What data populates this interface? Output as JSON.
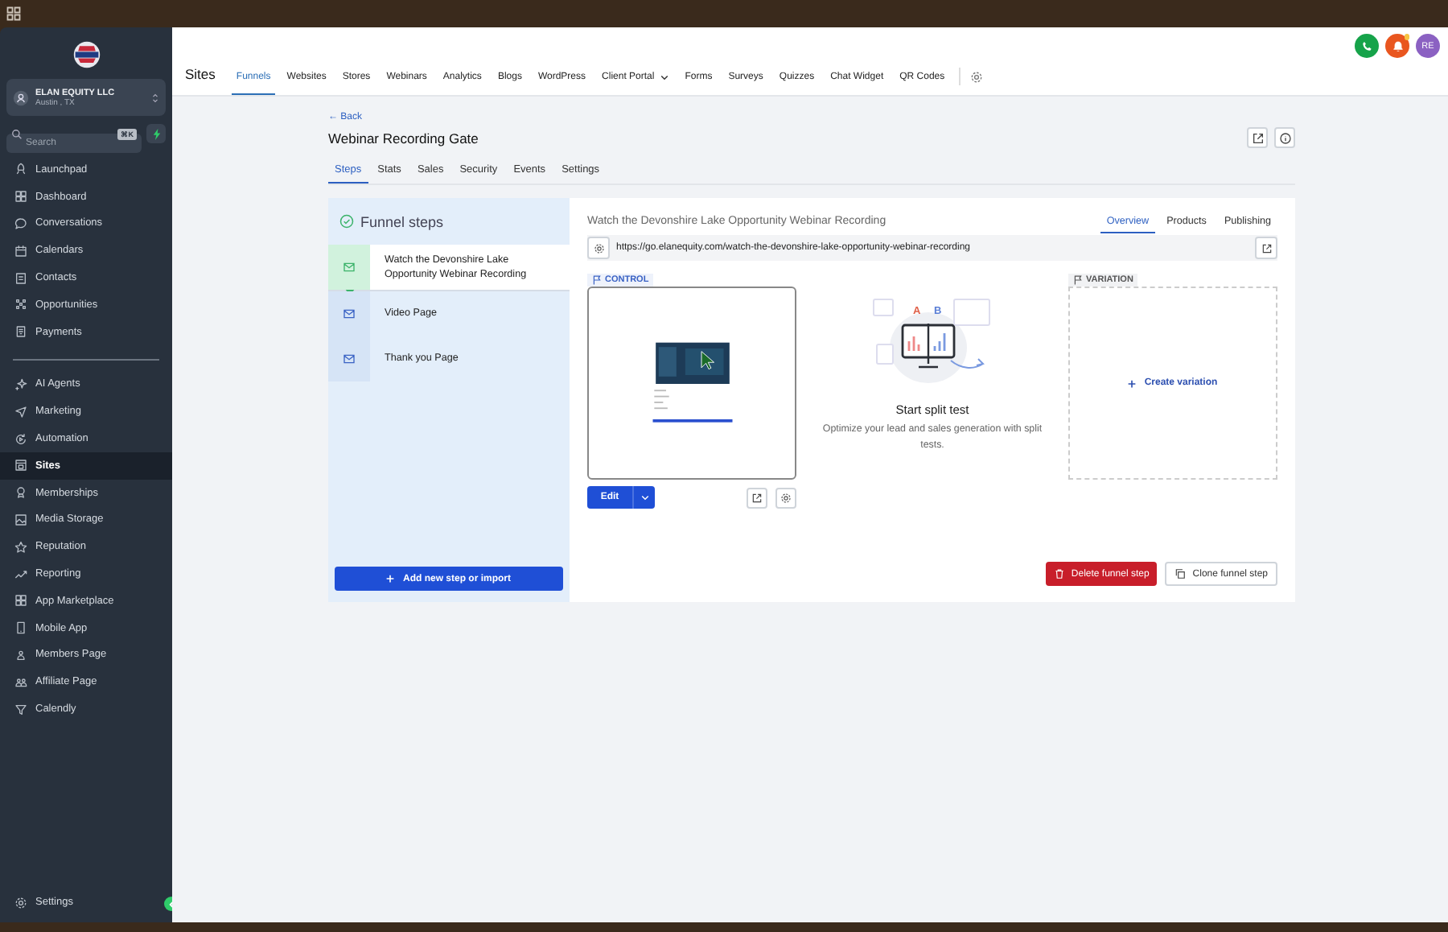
{
  "sidebar": {
    "account": {
      "name": "ELAN EQUITY LLC",
      "location": "Austin , TX"
    },
    "search": {
      "placeholder": "Search",
      "shortcut": "⌘K"
    },
    "groups": [
      [
        {
          "label": "Launchpad",
          "selected": false
        },
        {
          "label": "Dashboard",
          "selected": false
        },
        {
          "label": "Conversations",
          "selected": false
        },
        {
          "label": "Calendars",
          "selected": false
        },
        {
          "label": "Contacts",
          "selected": false
        },
        {
          "label": "Opportunities",
          "selected": false
        },
        {
          "label": "Payments",
          "selected": false
        }
      ],
      [
        {
          "label": "AI Agents",
          "selected": false
        },
        {
          "label": "Marketing",
          "selected": false
        },
        {
          "label": "Automation",
          "selected": false
        },
        {
          "label": "Sites",
          "selected": true
        },
        {
          "label": "Memberships",
          "selected": false
        },
        {
          "label": "Media Storage",
          "selected": false
        },
        {
          "label": "Reputation",
          "selected": false
        },
        {
          "label": "Reporting",
          "selected": false
        },
        {
          "label": "App Marketplace",
          "selected": false
        },
        {
          "label": "Mobile App",
          "selected": false
        },
        {
          "label": "Members Page",
          "selected": false
        },
        {
          "label": "Affiliate Page",
          "selected": false
        },
        {
          "label": "Calendly",
          "selected": false
        }
      ]
    ],
    "settings": "Settings"
  },
  "header": {
    "title": "Sites",
    "avatar": "RE",
    "nav": [
      {
        "label": "Funnels",
        "selected": true
      },
      {
        "label": "Websites",
        "selected": false
      },
      {
        "label": "Stores",
        "selected": false
      },
      {
        "label": "Webinars",
        "selected": false
      },
      {
        "label": "Analytics",
        "selected": false
      },
      {
        "label": "Blogs",
        "selected": false
      },
      {
        "label": "WordPress",
        "selected": false
      },
      {
        "label": "Client Portal",
        "selected": false,
        "dropdown": true
      },
      {
        "label": "Forms",
        "selected": false
      },
      {
        "label": "Surveys",
        "selected": false
      },
      {
        "label": "Quizzes",
        "selected": false
      },
      {
        "label": "Chat Widget",
        "selected": false
      },
      {
        "label": "QR Codes",
        "selected": false
      }
    ]
  },
  "page": {
    "back": "← Back",
    "title": "Webinar Recording Gate",
    "tabs": [
      {
        "label": "Steps",
        "selected": true
      },
      {
        "label": "Stats",
        "selected": false
      },
      {
        "label": "Sales",
        "selected": false
      },
      {
        "label": "Security",
        "selected": false
      },
      {
        "label": "Events",
        "selected": false
      },
      {
        "label": "Settings",
        "selected": false
      }
    ]
  },
  "funnel": {
    "title": "Funnel steps",
    "steps": [
      {
        "name": "Watch the Devonshire Lake Opportunity Webinar Recording",
        "selected": true
      },
      {
        "name": "Video Page",
        "selected": false
      },
      {
        "name": "Thank you Page",
        "selected": false
      }
    ],
    "add_button": "Add new step or import"
  },
  "step": {
    "title": "Watch the Devonshire Lake Opportunity Webinar Recording",
    "url": "https://go.elanequity.com/watch-the-devonshire-lake-opportunity-webinar-recording",
    "tabs": [
      {
        "label": "Overview",
        "selected": true
      },
      {
        "label": "Products",
        "selected": false
      },
      {
        "label": "Publishing",
        "selected": false
      }
    ],
    "control": "CONTROL",
    "edit": "Edit",
    "variation": "VARIATION",
    "create_variation": "Create variation",
    "split": {
      "a": "A",
      "b": "B",
      "title": "Start split test",
      "text": "Optimize your lead and sales generation with split tests."
    },
    "delete": "Delete funnel step",
    "clone": "Clone funnel step"
  }
}
